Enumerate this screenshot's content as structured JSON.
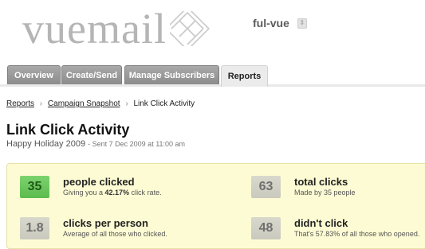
{
  "brand": {
    "logo_text": "vuemail",
    "account_name": "ful-vue",
    "account_menu_icon": "up-down-arrows-icon"
  },
  "tabs": [
    {
      "label": "Overview",
      "active": false
    },
    {
      "label": "Create/Send",
      "active": false
    },
    {
      "label": "Manage Subscribers",
      "active": false
    },
    {
      "label": "Reports",
      "active": true
    }
  ],
  "breadcrumb": {
    "items": [
      "Reports",
      "Campaign Snapshot"
    ],
    "current": "Link Click Activity",
    "separator": "›"
  },
  "page": {
    "title": "Link Click Activity",
    "campaign_name": "Happy Holiday 2009",
    "sent_info": "- Sent 7 Dec 2009 at 11:00 am"
  },
  "stats": {
    "people_clicked": {
      "value": "35",
      "title": "people clicked",
      "desc_prefix": "Giving you a ",
      "desc_highlight": "42.17%",
      "desc_suffix": " click rate."
    },
    "total_clicks": {
      "value": "63",
      "title": "total clicks",
      "desc": "Made by 35 people"
    },
    "clicks_per_person": {
      "value": "1.8",
      "title": "clicks per person",
      "desc": "Average of all those who clicked."
    },
    "didnt_click": {
      "value": "48",
      "title": "didn't click",
      "desc": "That's 57.83% of all those who opened."
    }
  },
  "colors": {
    "highlight_green": "#6cc85f",
    "panel_background": "#fdfbd3",
    "tab_background": "#9b9b9b",
    "tab_active_background": "#ebebeb"
  }
}
